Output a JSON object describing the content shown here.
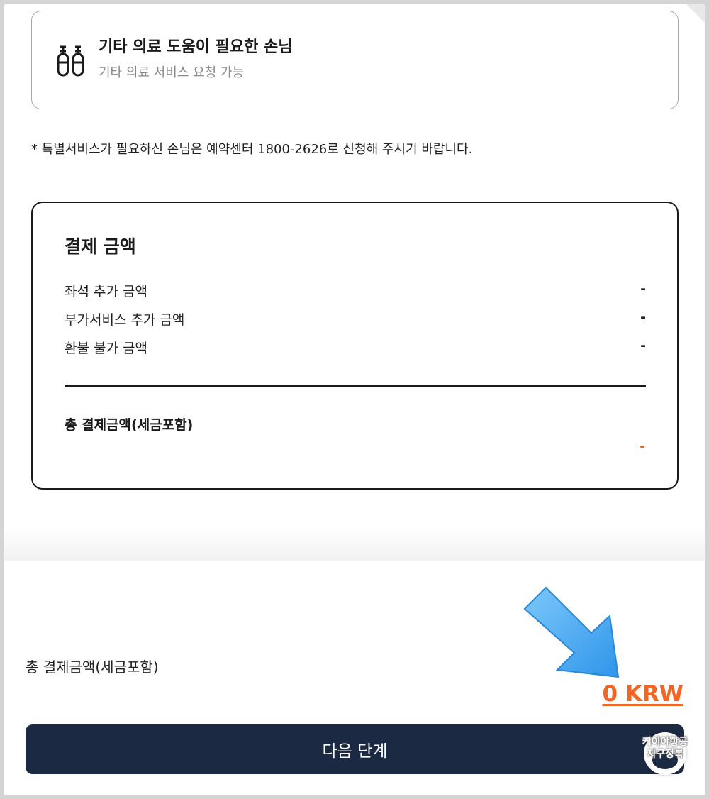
{
  "service": {
    "title": "기타 의료 도움이 필요한 손님",
    "description": "기타 의료 서비스 요청 가능",
    "icon": "oxygen-tank-icon"
  },
  "notice": "* 특별서비스가 필요하신 손님은 예약센터 1800-2626로 신청해 주시기 바랍니다.",
  "payment": {
    "title": "결제 금액",
    "rows": [
      {
        "label": "좌석 추가 금액",
        "value": "-"
      },
      {
        "label": "부가서비스 추가 금액",
        "value": "-"
      },
      {
        "label": "환불 불가 금액",
        "value": "-"
      }
    ],
    "total_label": "총 결제금액(세금포함)",
    "total_value": "-"
  },
  "footer": {
    "total_label": "총 결제금액(세금포함)",
    "total_amount": "0 KRW",
    "next_button": "다음 단계"
  },
  "chat": {
    "line1": "케이야항공",
    "line2": "지구정복",
    "icon": "chat-icon"
  },
  "colors": {
    "accent": "#f26522",
    "button_bg": "#1c2943",
    "arrow": "#4fb3f6"
  }
}
